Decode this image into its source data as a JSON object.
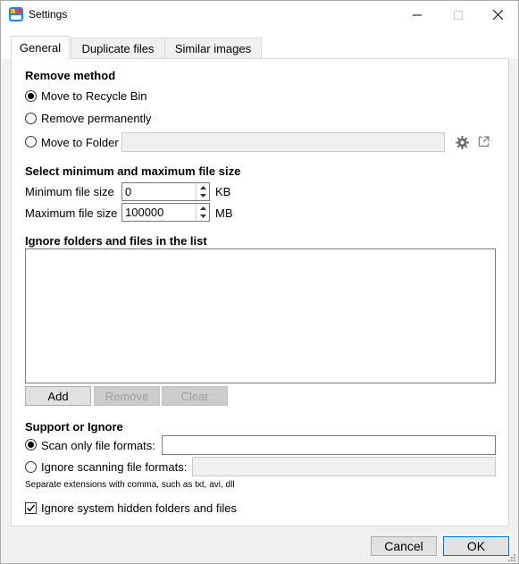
{
  "window": {
    "title": "Settings",
    "icon": "app-icon"
  },
  "tabs": [
    {
      "label": "General",
      "active": true
    },
    {
      "label": "Duplicate files",
      "active": false
    },
    {
      "label": "Similar images",
      "active": false
    }
  ],
  "remove_method": {
    "title": "Remove method",
    "options": [
      {
        "label": "Move to Recycle Bin",
        "checked": true
      },
      {
        "label": "Remove permanently",
        "checked": false
      },
      {
        "label": "Move to Folder",
        "checked": false
      }
    ],
    "folder_value": "",
    "icons": [
      "gear-icon",
      "open-external-icon"
    ]
  },
  "file_size": {
    "title": "Select minimum and maximum file size",
    "min_label": "Minimum file size",
    "min_value": "0",
    "min_unit": "KB",
    "max_label": "Maximum file size",
    "max_value": "100000",
    "max_unit": "MB"
  },
  "ignore_list": {
    "title": "Ignore folders and files in the list",
    "items": [],
    "add_label": "Add",
    "remove_label": "Remove",
    "clear_label": "Clear"
  },
  "support": {
    "title": "Support or Ignore",
    "scan_only_label": "Scan only file formats:",
    "scan_only_value": "",
    "ignore_label": "Ignore scanning file formats:",
    "ignore_value": "",
    "note": "Separate extensions with comma, such as txt, avi, dll"
  },
  "hidden": {
    "label": "Ignore system hidden folders and files",
    "checked": true
  },
  "footer": {
    "cancel_label": "Cancel",
    "ok_label": "OK"
  },
  "colors": {
    "accent": "#0078d7",
    "window_bg": "#f0f0f0",
    "panel_bg": "#ffffff"
  }
}
